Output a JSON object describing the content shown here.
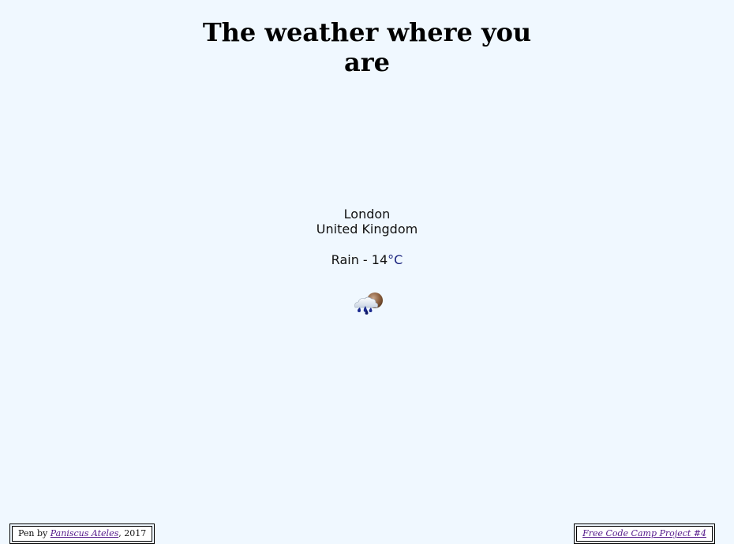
{
  "header": {
    "title": "The weather where you are"
  },
  "location": {
    "city": "London",
    "country": "United Kingdom"
  },
  "weather": {
    "description": "Rain",
    "separator": " - ",
    "temperature": "14",
    "unit": "°C",
    "icon": "rain-cloud-night-icon"
  },
  "footer": {
    "left_prefix": "Pen by ",
    "author": "Paniscus Ateles",
    "left_suffix": ", 2017",
    "right_link": "Free Code Camp Project #4"
  }
}
